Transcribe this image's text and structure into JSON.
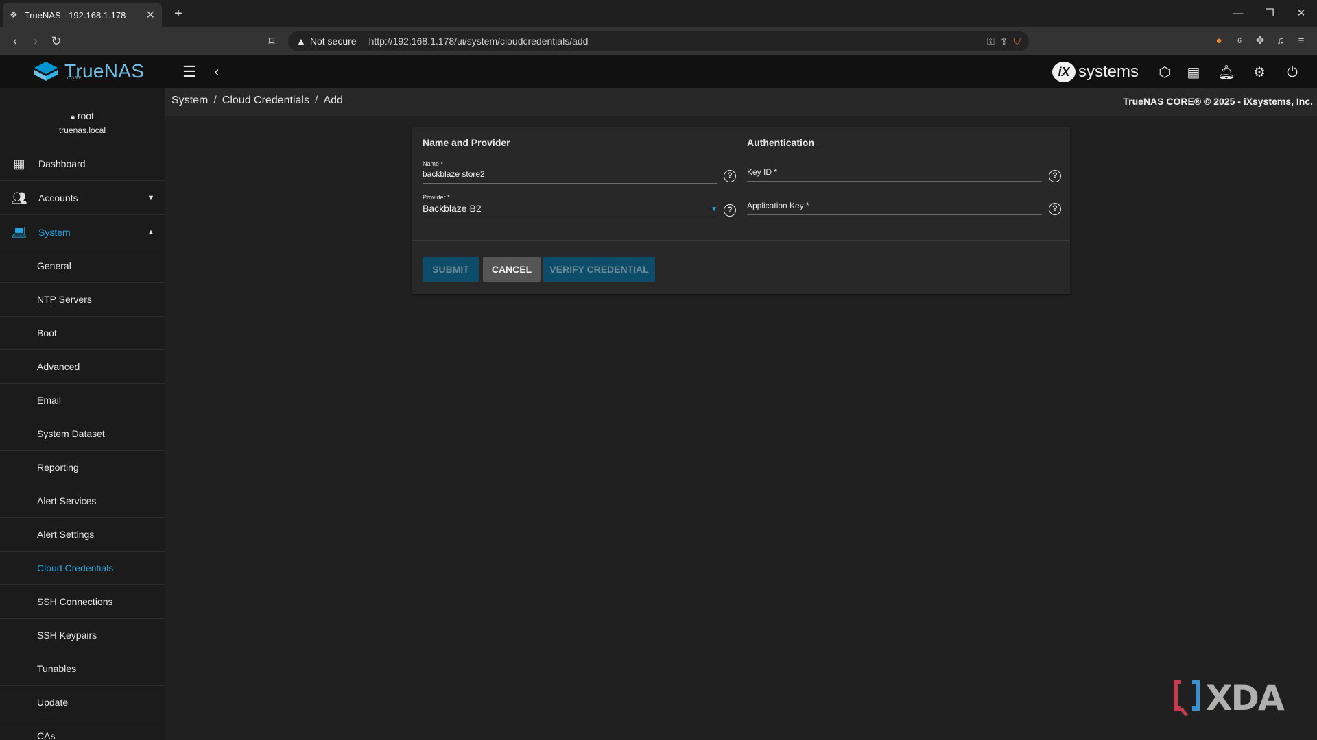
{
  "browser": {
    "tab_title": "TrueNAS - 192.168.1.178",
    "not_secure": "Not secure",
    "url": "http://192.168.1.178/ui/system/cloudcredentials/add"
  },
  "app": {
    "logo_text": "TrueNAS",
    "logo_sub": "CORE",
    "vendor": "systems",
    "copyright": "TrueNAS CORE® © 2025 - iXsystems, Inc."
  },
  "breadcrumb": [
    "System",
    "Cloud Credentials",
    "Add"
  ],
  "user": {
    "name": "root",
    "host": "truenas.local"
  },
  "sidebar": {
    "top_items": [
      {
        "label": "Dashboard",
        "icon": "dashboard-icon"
      },
      {
        "label": "Accounts",
        "icon": "people-icon"
      },
      {
        "label": "System",
        "icon": "laptop-icon"
      }
    ],
    "system_sub": [
      "General",
      "NTP Servers",
      "Boot",
      "Advanced",
      "Email",
      "System Dataset",
      "Reporting",
      "Alert Services",
      "Alert Settings",
      "Cloud Credentials",
      "SSH Connections",
      "SSH Keypairs",
      "Tunables",
      "Update",
      "CAs"
    ],
    "active_sub": "Cloud Credentials"
  },
  "form": {
    "section_left": "Name and Provider",
    "section_right": "Authentication",
    "name_label": "Name *",
    "name_value": "backblaze store2",
    "provider_label": "Provider *",
    "provider_value": "Backblaze B2",
    "keyid_label": "Key ID *",
    "appkey_label": "Application Key *",
    "submit": "SUBMIT",
    "cancel": "CANCEL",
    "verify": "VERIFY CREDENTIAL"
  },
  "watermark": "XDA",
  "colors": {
    "accent": "#2aa3e0",
    "primary_button": "#0e4d6a",
    "topbar": "#111111"
  }
}
